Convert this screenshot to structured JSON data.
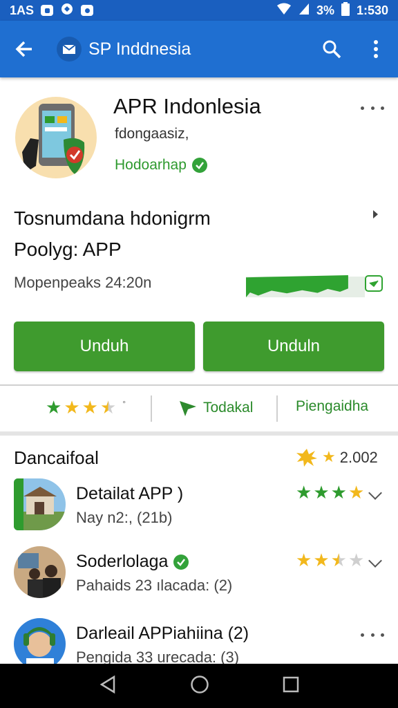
{
  "status_bar": {
    "left_time": "1AS",
    "battery": "3%",
    "time": "1:530",
    "icons": [
      "sim-icon",
      "vpn-icon",
      "notification-icon",
      "wifi-icon",
      "signal-icon",
      "battery-icon"
    ]
  },
  "app_bar": {
    "title": "SP Inddnesia",
    "icons": [
      "back-arrow-icon",
      "mail-icon",
      "search-icon",
      "overflow-menu-icon"
    ],
    "color": "#1f6fd1"
  },
  "app": {
    "name": "APR Indonlesia",
    "developer": "fdongaasiz,",
    "badge": "Hodoarhap",
    "subtitle_line1": "Tosnumdana  hdonigrm",
    "subtitle_line2": "Poolyg: APP",
    "updated": "Mopenpeaks 24:20n",
    "progress_percent": 86
  },
  "buttons": {
    "install_1": "Unduh",
    "install_2": "Unduln",
    "color": "#3f9b2e"
  },
  "info_row": {
    "rating_stars": 3.5,
    "rating_mark": "°",
    "tag_label": "Todakal",
    "link_label": "Piengaidha"
  },
  "reviews_section": {
    "title": "Dancaifoal",
    "rating": "2.002",
    "items": [
      {
        "title": "Detailat APP )",
        "subtitle": "Nay n2:, (21b)",
        "stars": 4,
        "star_color": "green-gold"
      },
      {
        "title": "Soderlolaga",
        "subtitle": "Pahaids 23 ılacada: (2)",
        "stars": 2.5,
        "star_color": "gold",
        "verified": true
      },
      {
        "title": "Darleail APPiahiina (2)",
        "subtitle": "Pengida 33 urecada: (3)"
      }
    ]
  },
  "nav_bar": {
    "icons": [
      "nav-back-icon",
      "nav-home-icon",
      "nav-recents-icon"
    ]
  }
}
